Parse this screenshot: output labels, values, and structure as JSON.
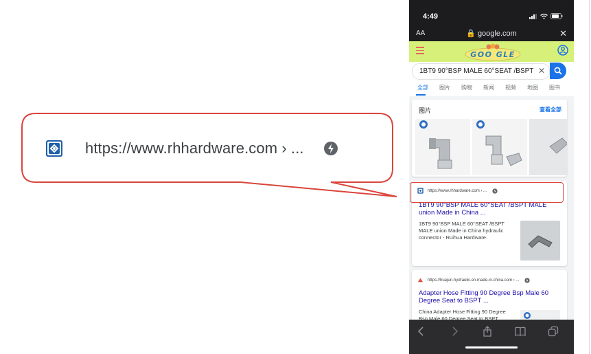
{
  "callout": {
    "url_text": "https://www.rhhardware.com › ...",
    "border_color": "#d9453b"
  },
  "status_bar": {
    "time": "4:49"
  },
  "address_bar": {
    "text_size_label": "AA",
    "domain": "google.com",
    "close_label": "✕"
  },
  "google": {
    "doodle_text": "GOO GLE",
    "search_query": "1BT9 90°BSP MALE 60°SEAT /BSPT MAL",
    "clear_label": "✕",
    "tabs": [
      {
        "label": "全部",
        "active": true
      },
      {
        "label": "图片",
        "active": false
      },
      {
        "label": "购物",
        "active": false
      },
      {
        "label": "新闻",
        "active": false
      },
      {
        "label": "视频",
        "active": false
      },
      {
        "label": "地图",
        "active": false
      },
      {
        "label": "图书",
        "active": false
      }
    ],
    "images_section": {
      "title": "图片",
      "see_all": "查看全部"
    },
    "results": [
      {
        "url": "https://www.rhhardware.com › ...",
        "title": "1BT9 90°BSP MALE 60°SEAT /BSPT MALE union Made in China ...",
        "snippet": "1BT9 90°BSP MALE 60°SEAT /BSPT MALE union Made in China hydraulic connector - Ruihua Hardware."
      },
      {
        "url": "https://huajun-hydraulic.en.made-in-china.com › ...",
        "title": "Adapter Hose Fitting 90 Degree Bsp Male 60 Degree Seat to BSPT ...",
        "snippet": "China Adapter Hose Fitting 90 Degree Bsp Male 60 Degree Seat to BSPT"
      }
    ]
  },
  "colors": {
    "accent": "#1a73e8",
    "link": "#1a0dab",
    "header_bg": "#d6f07a",
    "highlight": "#d9453b"
  }
}
